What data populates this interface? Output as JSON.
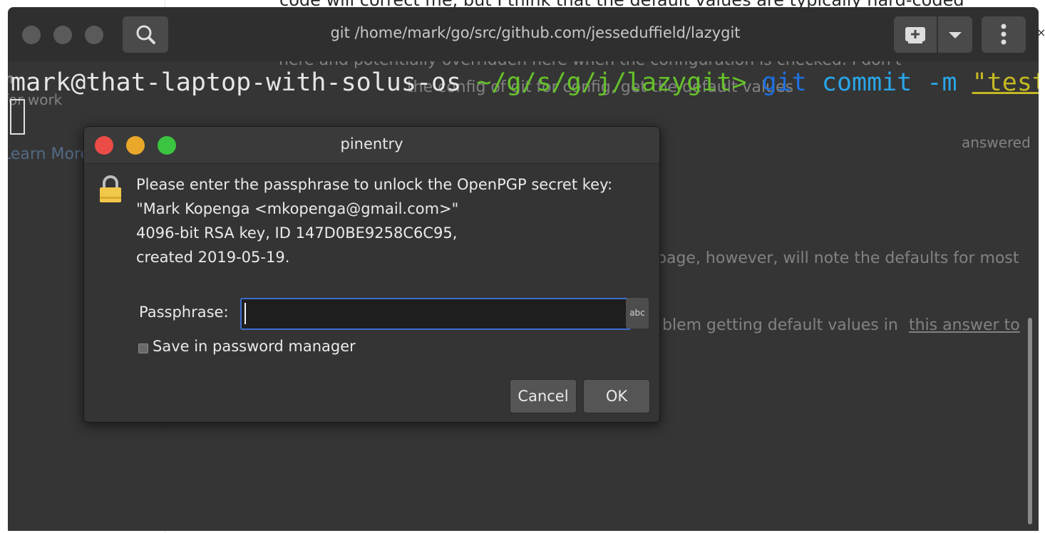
{
  "background_page": {
    "top_text": "code will correct me, but I think that the default values are typically hard-coded",
    "close_glyph": "×",
    "ghost": {
      "snippet_1": "here and potentially overridden here when the configuration is checked. I don't",
      "snippet_2": "the config of git for config, get the default values",
      "side_m": "m",
      "side_forwork": "for work",
      "learn_more": "Learn More",
      "answered": "answered",
      "body_1": "page, however, will note the defaults for most",
      "body_2": "blem getting default values in",
      "body_link": "this answer to"
    }
  },
  "terminal": {
    "title": "git /home/mark/go/src/github.com/jesseduffield/lazygit",
    "prompt_user": "mark@that-laptop-with-solus-os",
    "prompt_path": " ~/g/s/g/j/lazygit> ",
    "command": "git",
    "args": " commit -m ",
    "string_arg": "\"test\"",
    "icons": {
      "search": "search-icon",
      "new_tab": "new-tab-icon",
      "dropdown": "chevron-down-icon",
      "menu": "kebab-menu-icon"
    }
  },
  "dialog": {
    "title": "pinentry",
    "message_lines": [
      "Please enter the passphrase to unlock the OpenPGP secret key:",
      "\"Mark Kopenga <mkopenga@gmail.com>\"",
      "4096-bit RSA key, ID 147D0BE9258C6C95,",
      "created 2019-05-19."
    ],
    "passphrase_label": "Passphrase:",
    "passphrase_value": "",
    "abc_toggle": "abc",
    "save_label": "Save in password manager",
    "save_checked": false,
    "cancel_label": "Cancel",
    "ok_label": "OK",
    "colors": {
      "close": "#ec4c47",
      "minimize": "#e9a82a",
      "maximize": "#3bc441",
      "focus_ring": "#3b6ed0"
    }
  }
}
